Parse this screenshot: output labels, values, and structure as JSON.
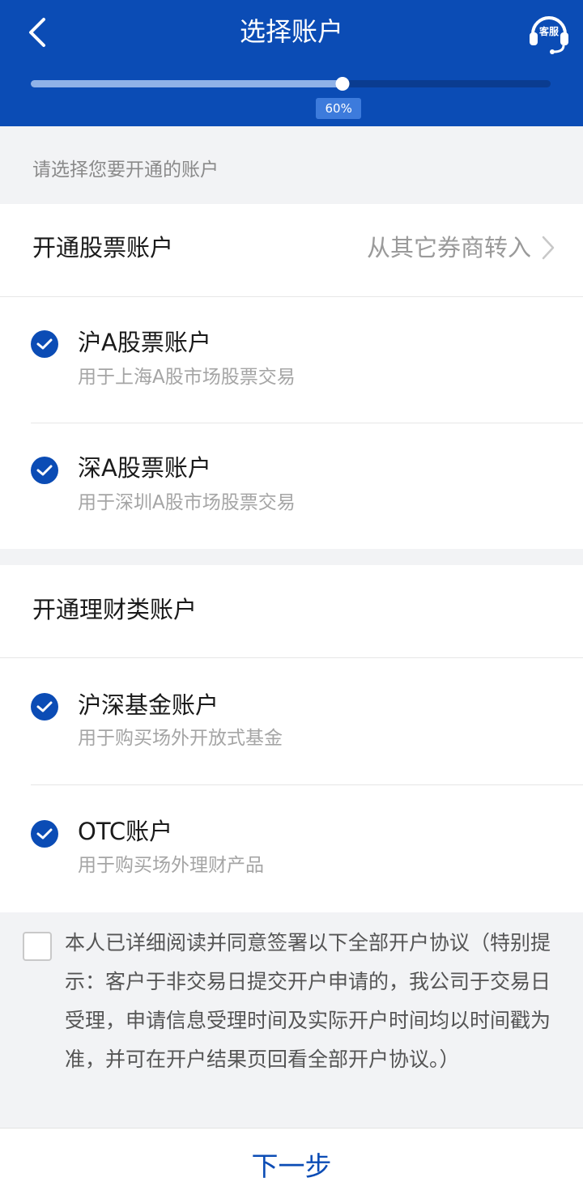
{
  "header": {
    "title": "选择账户",
    "back_icon": "chevron-left-icon",
    "service_label": "客服",
    "service_icon": "headset-icon",
    "progress_percent": 60,
    "progress_label": "60%"
  },
  "hint": "请选择您要开通的账户",
  "stock_section": {
    "title": "开通股票账户",
    "transfer_label": "从其它券商转入",
    "transfer_icon": "chevron-right-icon",
    "accounts": [
      {
        "name": "沪A股票账户",
        "desc": "用于上海A股市场股票交易",
        "checked": true
      },
      {
        "name": "深A股票账户",
        "desc": "用于深圳A股市场股票交易",
        "checked": true
      }
    ]
  },
  "finance_section": {
    "title": "开通理财类账户",
    "accounts": [
      {
        "name": "沪深基金账户",
        "desc": "用于购买场外开放式基金",
        "checked": true
      },
      {
        "name": "OTC账户",
        "desc": "用于购买场外理财产品",
        "checked": true
      }
    ]
  },
  "agreement": {
    "checked": false,
    "text": "本人已详细阅读并同意签署以下全部开户协议（特别提示：客户于非交易日提交开户申请的，我公司于交易日受理，申请信息受理时间及实际开户时间均以时间戳为准，并可在开户结果页回看全部开户协议。）"
  },
  "footer": {
    "next_label": "下一步"
  },
  "colors": {
    "brand": "#0b4cb5",
    "progress_fill": "#8fb2e8",
    "progress_label_bg": "#3d7bdc"
  }
}
